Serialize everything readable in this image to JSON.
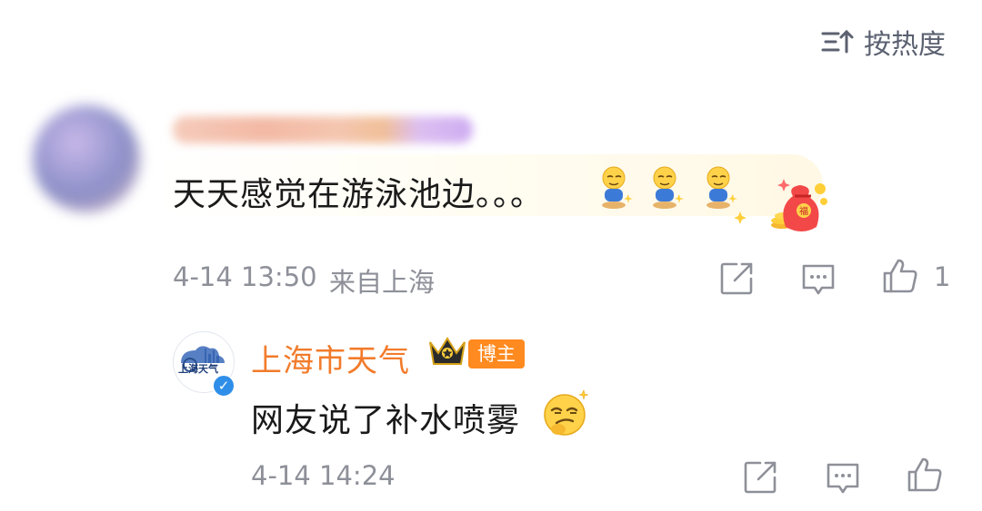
{
  "sort": {
    "label": "按热度",
    "icon": "sort-icon"
  },
  "comment": {
    "text": "天天感觉在游泳池边。。。",
    "time": "4-14 13:50",
    "location": "来自上海",
    "like_count": "1",
    "emoji_sticker": "person-sweating-emoji",
    "decoration": "lucky-bag-coins"
  },
  "reply": {
    "author": "上海市天气",
    "badge": "博主",
    "avatar_text": "上海天气",
    "verified_mark": "✓",
    "text": "网友说了补水喷雾",
    "emoji": "smirk-emoji",
    "time": "4-14 14:24"
  },
  "colors": {
    "author_orange": "#f27b2b",
    "badge_orange": "#ff8a1f",
    "meta_gray": "#8e9099",
    "verify_blue": "#2f8fe8"
  }
}
